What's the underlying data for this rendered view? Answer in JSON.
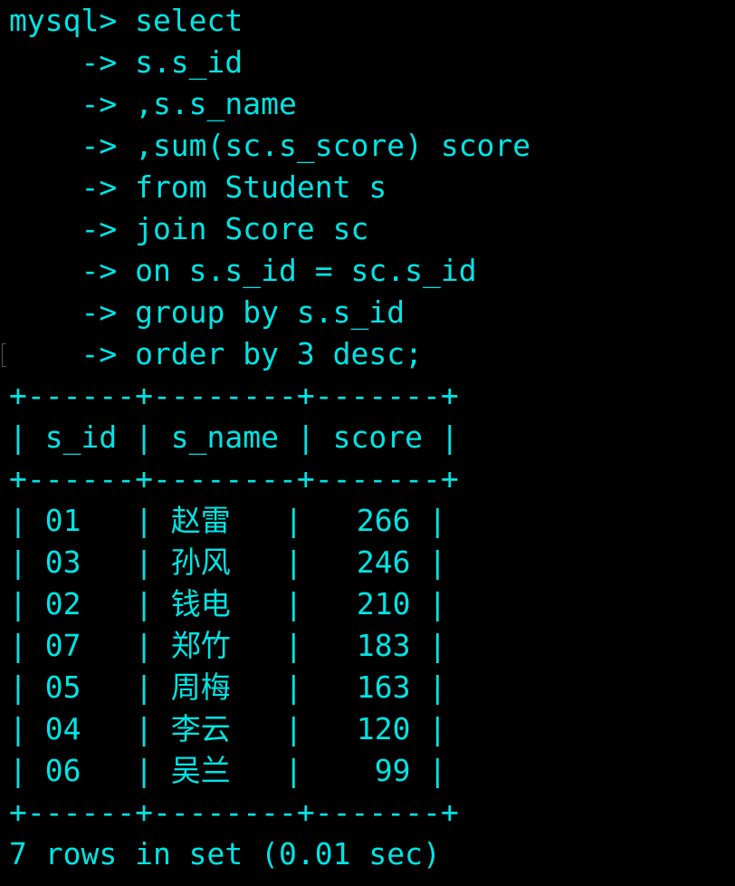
{
  "terminal": {
    "colors": {
      "background": "#000000",
      "text": "#00E5E5"
    },
    "lines": [
      "mysql> select",
      "    -> s.s_id",
      "    -> ,s.s_name",
      "    -> ,sum(sc.s_score) score",
      "    -> from Student s",
      "    -> join Score sc",
      "    -> on s.s_id = sc.s_id",
      "    -> group by s.s_id",
      "    -> order by 3 desc;",
      "+------+--------+-------+",
      "| s_id | s_name | score |",
      "+------+--------+-------+",
      "| 01   | 赵雷   |   266 |",
      "| 03   | 孙风   |   246 |",
      "| 02   | 钱电   |   210 |",
      "| 07   | 郑竹   |   183 |",
      "| 05   | 周梅   |   163 |",
      "| 04   | 李云   |   120 |",
      "| 06   | 吴兰   |    99 |",
      "+------+--------+-------+",
      "7 rows in set (0.01 sec)"
    ]
  }
}
